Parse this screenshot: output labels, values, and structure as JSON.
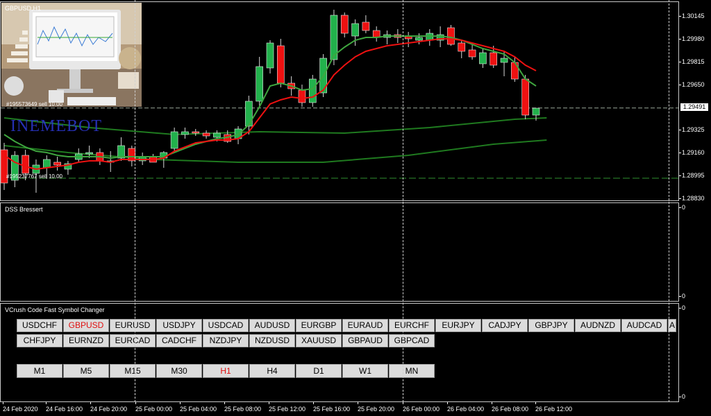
{
  "chart": {
    "symbol_label": "GBPUSD,H1",
    "bid_price": "1.29491",
    "price_ticks": [
      "1.30145",
      "1.29980",
      "1.29815",
      "1.29650",
      "1.29325",
      "1.29160",
      "1.28995",
      "1.28830"
    ],
    "order_labels": [
      "#195573649 sell 10.00",
      "#195237767 sell 10.00"
    ],
    "watermark": "INEMEBOT",
    "colors": {
      "bull": "#22b14c",
      "bear": "#ee1111",
      "ma_red": "#ee1111",
      "ma_green": "#3fa63f",
      "ma_dark": "#1f7a1f"
    },
    "candles": [
      {
        "o": 1.2919,
        "h": 1.2924,
        "l": 1.289,
        "c": 1.2895
      },
      {
        "o": 1.2897,
        "h": 1.2918,
        "l": 1.2892,
        "c": 1.2915
      },
      {
        "o": 1.2915,
        "h": 1.2919,
        "l": 1.2897,
        "c": 1.2902
      },
      {
        "o": 1.2902,
        "h": 1.2912,
        "l": 1.2888,
        "c": 1.2908
      },
      {
        "o": 1.2906,
        "h": 1.2915,
        "l": 1.2898,
        "c": 1.2912
      },
      {
        "o": 1.291,
        "h": 1.2914,
        "l": 1.2904,
        "c": 1.2908
      },
      {
        "o": 1.2905,
        "h": 1.2911,
        "l": 1.2901,
        "c": 1.2909
      },
      {
        "o": 1.2912,
        "h": 1.292,
        "l": 1.291,
        "c": 1.2916
      },
      {
        "o": 1.2916,
        "h": 1.2922,
        "l": 1.2913,
        "c": 1.2917
      },
      {
        "o": 1.2917,
        "h": 1.292,
        "l": 1.2908,
        "c": 1.2911
      },
      {
        "o": 1.291,
        "h": 1.2918,
        "l": 1.2903,
        "c": 1.2911
      },
      {
        "o": 1.2913,
        "h": 1.2928,
        "l": 1.2911,
        "c": 1.2922
      },
      {
        "o": 1.292,
        "h": 1.2922,
        "l": 1.2907,
        "c": 1.2911
      },
      {
        "o": 1.2911,
        "h": 1.2917,
        "l": 1.2908,
        "c": 1.2914
      },
      {
        "o": 1.2914,
        "h": 1.2916,
        "l": 1.291,
        "c": 1.291
      },
      {
        "o": 1.2913,
        "h": 1.2918,
        "l": 1.2906,
        "c": 1.2917
      },
      {
        "o": 1.292,
        "h": 1.2935,
        "l": 1.2918,
        "c": 1.2932
      },
      {
        "o": 1.293,
        "h": 1.2935,
        "l": 1.2927,
        "c": 1.2932
      },
      {
        "o": 1.2932,
        "h": 1.2934,
        "l": 1.2929,
        "c": 1.2931
      },
      {
        "o": 1.2931,
        "h": 1.2933,
        "l": 1.2927,
        "c": 1.2929
      },
      {
        "o": 1.2928,
        "h": 1.2933,
        "l": 1.2925,
        "c": 1.2931
      },
      {
        "o": 1.293,
        "h": 1.2933,
        "l": 1.2924,
        "c": 1.2925
      },
      {
        "o": 1.2927,
        "h": 1.2936,
        "l": 1.2923,
        "c": 1.2934
      },
      {
        "o": 1.2936,
        "h": 1.2958,
        "l": 1.293,
        "c": 1.2954
      },
      {
        "o": 1.2954,
        "h": 1.2986,
        "l": 1.295,
        "c": 1.2979
      },
      {
        "o": 1.2978,
        "h": 1.2998,
        "l": 1.2974,
        "c": 1.2996
      },
      {
        "o": 1.2994,
        "h": 1.2999,
        "l": 1.2964,
        "c": 1.2967
      },
      {
        "o": 1.2967,
        "h": 1.2972,
        "l": 1.2958,
        "c": 1.2963
      },
      {
        "o": 1.2962,
        "h": 1.2966,
        "l": 1.295,
        "c": 1.2953
      },
      {
        "o": 1.2953,
        "h": 1.2973,
        "l": 1.295,
        "c": 1.297
      },
      {
        "o": 1.296,
        "h": 1.2988,
        "l": 1.2957,
        "c": 1.2985
      },
      {
        "o": 1.2984,
        "h": 1.302,
        "l": 1.298,
        "c": 1.3016
      },
      {
        "o": 1.3016,
        "h": 1.3018,
        "l": 1.3,
        "c": 1.3003
      },
      {
        "o": 1.3001,
        "h": 1.3013,
        "l": 1.2994,
        "c": 1.301
      },
      {
        "o": 1.3011,
        "h": 1.3016,
        "l": 1.3003,
        "c": 1.3005
      },
      {
        "o": 1.3005,
        "h": 1.3008,
        "l": 1.2997,
        "c": 1.3
      },
      {
        "o": 1.3,
        "h": 1.3005,
        "l": 1.2995,
        "c": 1.3002
      },
      {
        "o": 1.3002,
        "h": 1.3006,
        "l": 1.2996,
        "c": 1.3
      },
      {
        "o": 1.3001,
        "h": 1.3004,
        "l": 1.2993,
        "c": 1.2999
      },
      {
        "o": 1.2998,
        "h": 1.3003,
        "l": 1.2995,
        "c": 1.3
      },
      {
        "o": 1.2998,
        "h": 1.3006,
        "l": 1.2994,
        "c": 1.3003
      },
      {
        "o": 1.2998,
        "h": 1.3008,
        "l": 1.2993,
        "c": 1.3002
      },
      {
        "o": 1.3007,
        "h": 1.3009,
        "l": 1.2994,
        "c": 1.2995
      },
      {
        "o": 1.2996,
        "h": 1.2998,
        "l": 1.2985,
        "c": 1.299
      },
      {
        "o": 1.2991,
        "h": 1.2995,
        "l": 1.2984,
        "c": 1.2986
      },
      {
        "o": 1.2981,
        "h": 1.2992,
        "l": 1.2978,
        "c": 1.2989
      },
      {
        "o": 1.2989,
        "h": 1.2994,
        "l": 1.2978,
        "c": 1.298
      },
      {
        "o": 1.2982,
        "h": 1.299,
        "l": 1.2972,
        "c": 1.2985
      },
      {
        "o": 1.2982,
        "h": 1.2986,
        "l": 1.2968,
        "c": 1.297
      },
      {
        "o": 1.297,
        "h": 1.2973,
        "l": 1.2941,
        "c": 1.2944
      },
      {
        "o": 1.2944,
        "h": 1.2948,
        "l": 1.294,
        "c": 1.2949
      }
    ],
    "ma_red": [
      1.2915,
      1.291,
      1.2907,
      1.2905,
      1.2906,
      1.2907,
      1.2908,
      1.291,
      1.2911,
      1.2911,
      1.291,
      1.2912,
      1.2912,
      1.2912,
      1.2912,
      1.2913,
      1.2918,
      1.2921,
      1.2924,
      1.2925,
      1.2926,
      1.2926,
      1.2927,
      1.2932,
      1.2942,
      1.2952,
      1.2955,
      1.2957,
      1.2956,
      1.2957,
      1.2962,
      1.2973,
      1.298,
      1.2986,
      1.299,
      1.2992,
      1.2994,
      1.2995,
      1.2996,
      1.2997,
      1.2998,
      1.2999,
      1.2999,
      1.2998,
      1.2996,
      1.2994,
      1.2992,
      1.299,
      1.2986,
      1.298,
      1.2976
    ],
    "ma_green": [
      1.293,
      1.2925,
      1.2921,
      1.2918,
      1.2917,
      1.2915,
      1.2914,
      1.2914,
      1.2914,
      1.2914,
      1.2913,
      1.2914,
      1.2914,
      1.2914,
      1.2914,
      1.2914,
      1.2917,
      1.292,
      1.2923,
      1.2925,
      1.2927,
      1.2928,
      1.293,
      1.2937,
      1.295,
      1.2965,
      1.2967,
      1.2965,
      1.2962,
      1.2963,
      1.2972,
      1.2987,
      1.2993,
      1.2998,
      1.3,
      1.3,
      1.3001,
      1.3001,
      1.3001,
      1.3001,
      1.3001,
      1.3001,
      1.3,
      1.2998,
      1.2995,
      1.2992,
      1.299,
      1.2988,
      1.2982,
      1.297,
      1.2965
    ],
    "ma_slow1": [
      [
        0,
        1.2942
      ],
      [
        8,
        1.2935
      ],
      [
        16,
        1.293
      ],
      [
        24,
        1.2932
      ],
      [
        32,
        1.2931
      ],
      [
        40,
        1.2935
      ],
      [
        48,
        1.2941
      ],
      [
        51,
        1.2942
      ]
    ],
    "ma_slow2": [
      [
        0,
        1.2922
      ],
      [
        6,
        1.2917
      ],
      [
        14,
        1.2912
      ],
      [
        22,
        1.291
      ],
      [
        30,
        1.291
      ],
      [
        38,
        1.2915
      ],
      [
        46,
        1.2923
      ],
      [
        51,
        1.2926
      ]
    ]
  },
  "dss": {
    "title": "DSS Bressert",
    "ticks": [
      "0",
      "0"
    ]
  },
  "changer": {
    "title": "VCrush Code Fast Symbol Changer",
    "axis_ticks": [
      "0",
      "0"
    ],
    "symbols_row1": [
      "USDCHF",
      "GBPUSD",
      "EURUSD",
      "USDJPY",
      "USDCAD",
      "AUDUSD",
      "EURGBP",
      "EURAUD",
      "EURCHF",
      "EURJPY",
      "CADJPY",
      "GBPJPY",
      "AUDNZD",
      "AUDCAD",
      "AUDCHF"
    ],
    "symbols_row2": [
      "CHFJPY",
      "EURNZD",
      "EURCAD",
      "CADCHF",
      "NZDJPY",
      "NZDUSD",
      "XAUUSD",
      "GBPAUD",
      "GBPCAD"
    ],
    "timeframes": [
      "M1",
      "M5",
      "M15",
      "M30",
      "H1",
      "H4",
      "D1",
      "W1",
      "MN"
    ],
    "active_symbol": "GBPUSD",
    "active_timeframe": "H1"
  },
  "time_axis": [
    "24 Feb 2020",
    "24 Feb 16:00",
    "24 Feb 20:00",
    "25 Feb 00:00",
    "25 Feb 04:00",
    "25 Feb 08:00",
    "25 Feb 12:00",
    "25 Feb 16:00",
    "25 Feb 20:00",
    "26 Feb 00:00",
    "26 Feb 04:00",
    "26 Feb 08:00",
    "26 Feb 12:00"
  ]
}
